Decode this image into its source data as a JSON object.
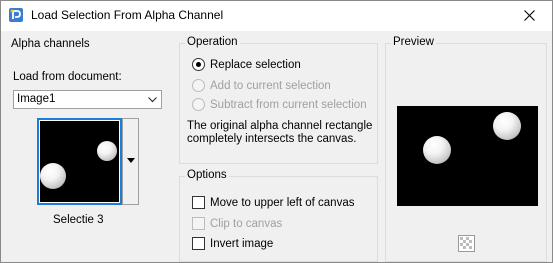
{
  "window": {
    "title": "Load Selection From Alpha Channel",
    "icon": "paintshop-icon",
    "close_icon": "close-icon"
  },
  "alpha_channels": {
    "group_label": "Alpha channels",
    "load_label": "Load from document:",
    "document_selected": "Image1",
    "channel_name": "Selectie 3"
  },
  "operation": {
    "group_label": "Operation",
    "options": [
      {
        "label": "Replace selection",
        "checked": true,
        "enabled": true
      },
      {
        "label": "Add to current selection",
        "checked": false,
        "enabled": false
      },
      {
        "label": "Subtract from current selection",
        "checked": false,
        "enabled": false
      }
    ],
    "info": "The original alpha channel rectangle completely intersects the canvas."
  },
  "options": {
    "group_label": "Options",
    "items": [
      {
        "label": "Move to upper left of canvas",
        "checked": false,
        "enabled": true
      },
      {
        "label": "Clip to canvas",
        "checked": false,
        "enabled": false
      },
      {
        "label": "Invert image",
        "checked": false,
        "enabled": true
      }
    ]
  },
  "preview": {
    "group_label": "Preview",
    "icon": "transparency-checker-icon"
  },
  "colors": {
    "selected_border": "#1e7bd6",
    "preview_bg": "#000000",
    "dialog_bg": "#f0f0f0"
  }
}
